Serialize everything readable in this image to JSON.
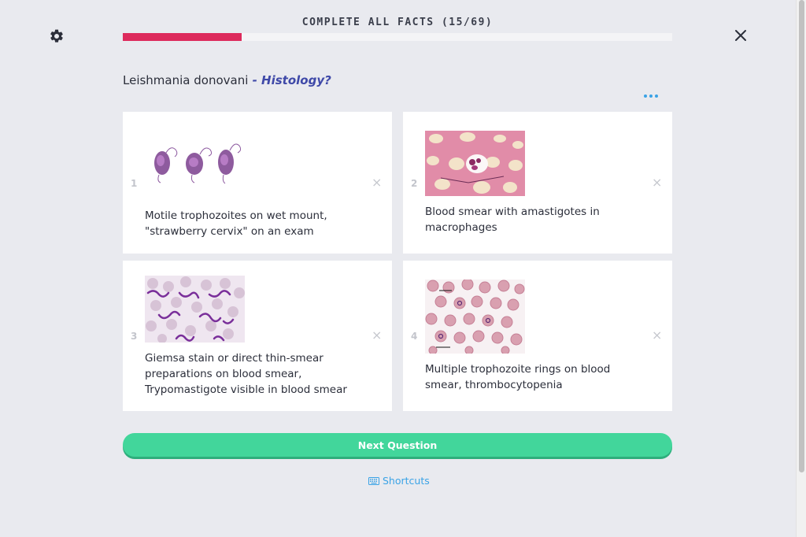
{
  "header": {
    "title": "COMPLETE ALL FACTS (15/69)",
    "progress_fraction": 0.217
  },
  "icons": {
    "settings": "gear-icon",
    "close": "close-icon",
    "more": "more-options-icon",
    "keyboard": "keyboard-icon"
  },
  "colors": {
    "progress": "#dd2a5c",
    "accent": "#3f49a8",
    "button": "#42d69b",
    "link": "#3aa3e6"
  },
  "question": {
    "subject": "Leishmania donovani",
    "separator": " - ",
    "topic": "Histology?"
  },
  "cards": [
    {
      "number": "1",
      "text_line1": "Motile trophozoites on wet mount,",
      "text_line2": "\"strawberry cervix\" on an exam",
      "text_line3": ""
    },
    {
      "number": "2",
      "text_line1": "Blood smear with amastigotes in",
      "text_line2": "macrophages",
      "text_line3": ""
    },
    {
      "number": "3",
      "text_line1": "Giemsa stain or direct thin-smear",
      "text_line2": "preparations on blood smear,",
      "text_line3": "Trypomastigote visible in blood smear"
    },
    {
      "number": "4",
      "text_line1": "Multiple trophozoite rings on blood",
      "text_line2": "smear, thrombocytopenia",
      "text_line3": ""
    }
  ],
  "card_close_glyph": "×",
  "next_button": {
    "label": "Next Question"
  },
  "shortcuts": {
    "label": "Shortcuts"
  }
}
